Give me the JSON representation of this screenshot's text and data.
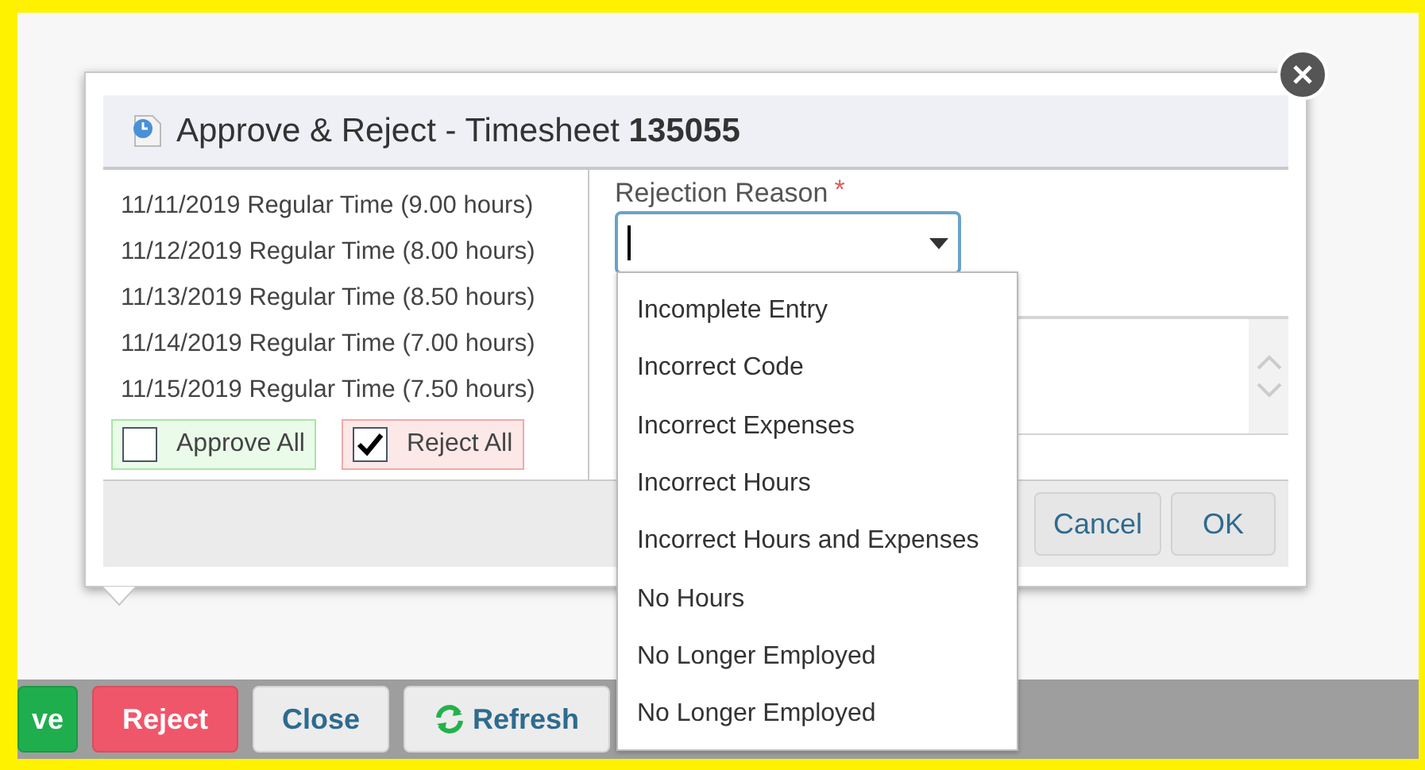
{
  "dialog": {
    "title": "Approve & Reject - Timesheet **135055**",
    "entries": [
      "11/11/2019 Regular Time (9.00 hours)",
      "11/12/2019 Regular Time (8.00 hours)",
      "11/13/2019 Regular Time (8.50 hours)",
      "11/14/2019 Regular Time (7.00 hours)",
      "11/15/2019 Regular Time (7.50 hours)"
    ],
    "checks": [
      {
        "label": "Approve All",
        "kind": "approve",
        "checked": false
      },
      {
        "label": "Reject All",
        "kind": "reject",
        "checked": true
      }
    ],
    "rejection_reason": {
      "label": "Rejection Reason",
      "required": "*",
      "expanded": true,
      "options": [
        "Incomplete Entry",
        "Incorrect Code",
        "Incorrect Expenses",
        "Incorrect Hours",
        "Incorrect Hours and Expenses",
        "No Hours",
        "No Longer Employed",
        "No Longer Employed"
      ]
    },
    "buttons": [
      "Cancel",
      "OK"
    ]
  },
  "toolbar": [
    {
      "label": "ve",
      "kind": "approve"
    },
    {
      "label": "Reject",
      "kind": "reject"
    },
    {
      "label": "Close",
      "kind": "plain"
    },
    {
      "label": "Refresh",
      "kind": "refresh"
    }
  ]
}
